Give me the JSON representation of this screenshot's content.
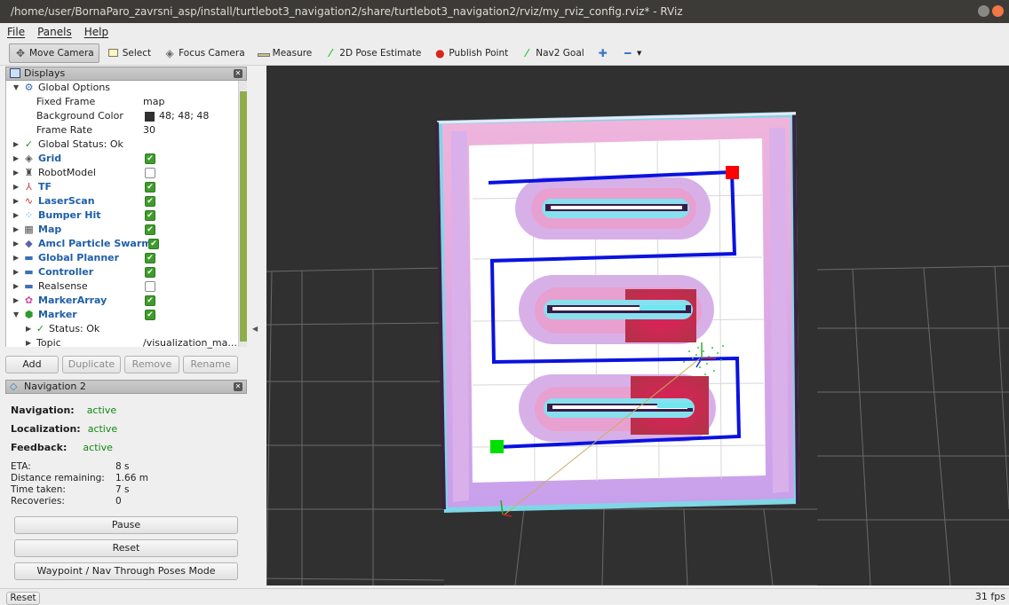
{
  "window": {
    "title": "/home/user/BornaParo_zavrsni_asp/install/turtlebot3_navigation2/share/turtlebot3_navigation2/rviz/my_rviz_config.rviz* - RViz"
  },
  "menu": [
    "File",
    "Panels",
    "Help"
  ],
  "toolbar": {
    "move_camera": "Move Camera",
    "select": "Select",
    "focus_camera": "Focus Camera",
    "measure": "Measure",
    "pose_estimate": "2D Pose Estimate",
    "publish_point": "Publish Point",
    "nav2_goal": "Nav2 Goal"
  },
  "displays": {
    "title": "Displays",
    "global_options": "Global Options",
    "fixed_frame_label": "Fixed Frame",
    "fixed_frame_value": "map",
    "bg_color_label": "Background Color",
    "bg_color_value": "48; 48; 48",
    "frame_rate_label": "Frame Rate",
    "frame_rate_value": "30",
    "global_status": "Global Status: Ok",
    "items": [
      "Grid",
      "RobotModel",
      "TF",
      "LaserScan",
      "Bumper Hit",
      "Map",
      "Amcl Particle Swarm",
      "Global Planner",
      "Controller",
      "Realsense",
      "MarkerArray",
      "Marker"
    ],
    "status_ok": "Status: Ok",
    "topic_label": "Topic",
    "topic_value": "/visualization_ma...",
    "buttons": {
      "add": "Add",
      "duplicate": "Duplicate",
      "remove": "Remove",
      "rename": "Rename"
    }
  },
  "navigation": {
    "title": "Navigation 2",
    "navigation_label": "Navigation:",
    "navigation_value": "active",
    "localization_label": "Localization:",
    "localization_value": "active",
    "feedback_label": "Feedback:",
    "feedback_value": "active",
    "eta_label": "ETA:",
    "eta_value": "8 s",
    "distance_label": "Distance remaining:",
    "distance_value": "1.66 m",
    "time_label": "Time taken:",
    "time_value": "7 s",
    "recoveries_label": "Recoveries:",
    "recoveries_value": "0",
    "pause": "Pause",
    "reset": "Reset",
    "waypoint_mode": "Waypoint / Nav Through Poses Mode"
  },
  "statusbar": {
    "reset": "Reset",
    "fps": "31 fps"
  },
  "colors": {
    "background": "#303030",
    "path": "#0010e0",
    "goal_start": "#ff0000",
    "goal_end": "#00dd00"
  }
}
